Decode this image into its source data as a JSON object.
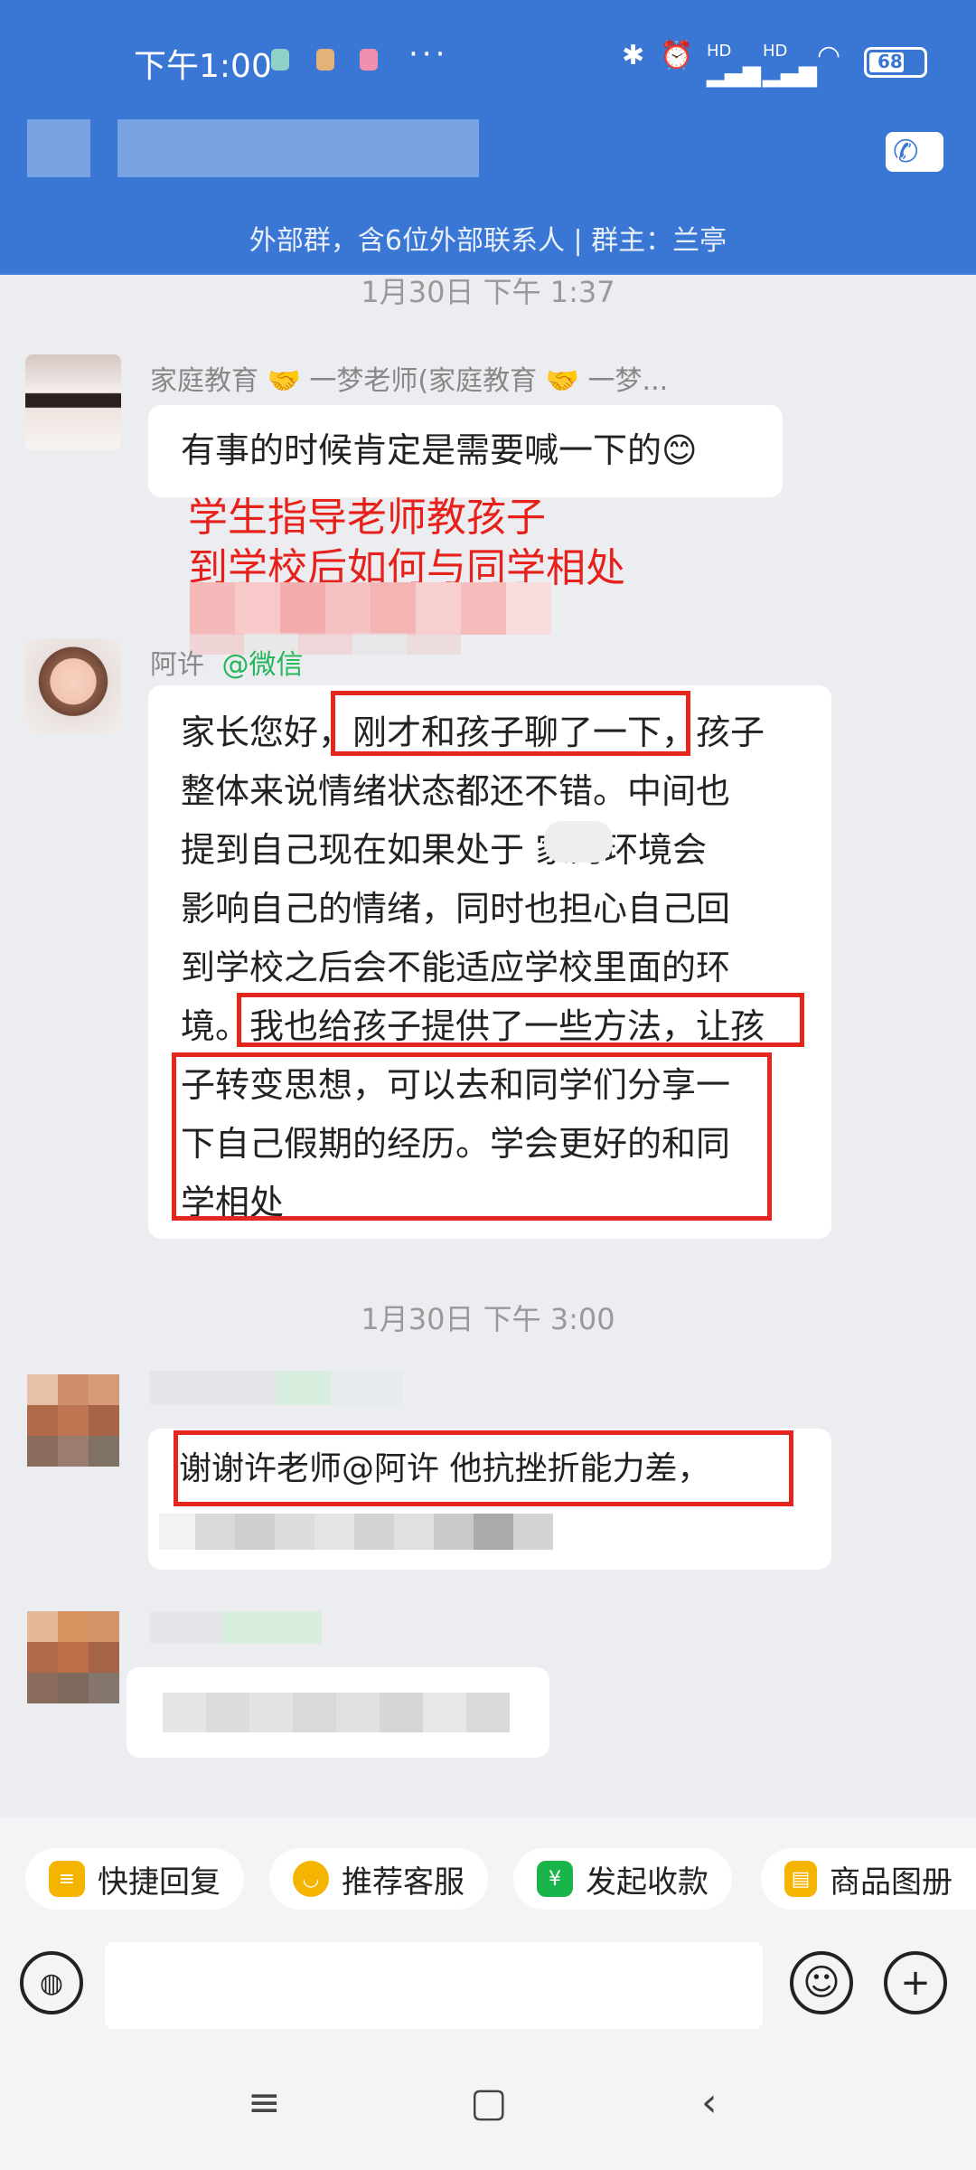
{
  "status_bar": {
    "time": "下午1:00",
    "more": "···",
    "battery": "68",
    "hd1": "HD",
    "hd2": "HD"
  },
  "header": {
    "group_info": "外部群，含6位外部联系人 | 群主：兰亭"
  },
  "chat": {
    "timestamp_1": "1月30日  下午 1:37",
    "msg1": {
      "sender": "家庭教育 🤝 一梦老师(家庭教育 🤝 一梦...",
      "text": "有事的时候肯定是需要喊一下的😊"
    },
    "overlay_caption": [
      "学生指导老师教孩子",
      "到学校后如何与同学相处"
    ],
    "msg2": {
      "sender_name": "阿许",
      "sender_tag": "@微信",
      "lines": [
        "家长您好，刚才和孩子聊了一下，孩子",
        "整体来说情绪状态都还不错。中间也",
        "提到自己现在如果处于    家的环境会",
        "影响自己的情绪，同时也担心自己回",
        "到学校之后会不能适应学校里面的环",
        "境。我也给孩子提供了一些方法，让孩",
        "子转变思想，可以去和同学们分享一",
        "下自己假期的经历。学会更好的和同",
        "学相处"
      ]
    },
    "timestamp_2": "1月30日  下午 3:00",
    "msg3": {
      "text": "谢谢许老师@阿许 他抗挫折能力差，"
    }
  },
  "quick_actions": [
    {
      "label": "快捷回复",
      "icon": "quick-reply-icon",
      "color": "#f4b400"
    },
    {
      "label": "推荐客服",
      "icon": "recommend-service-icon",
      "color": "#f4b400"
    },
    {
      "label": "发起收款",
      "icon": "payment-icon",
      "color": "#19b54a"
    },
    {
      "label": "商品图册",
      "icon": "product-album-icon",
      "color": "#f4b400"
    }
  ],
  "input_bar": {
    "voice_icon": "voice-icon",
    "emoji_icon": "emoji-icon",
    "plus_icon": "plus-icon"
  },
  "colors": {
    "header": "#3a77d4",
    "highlight": "#e5261f",
    "caption": "#e8201b"
  }
}
